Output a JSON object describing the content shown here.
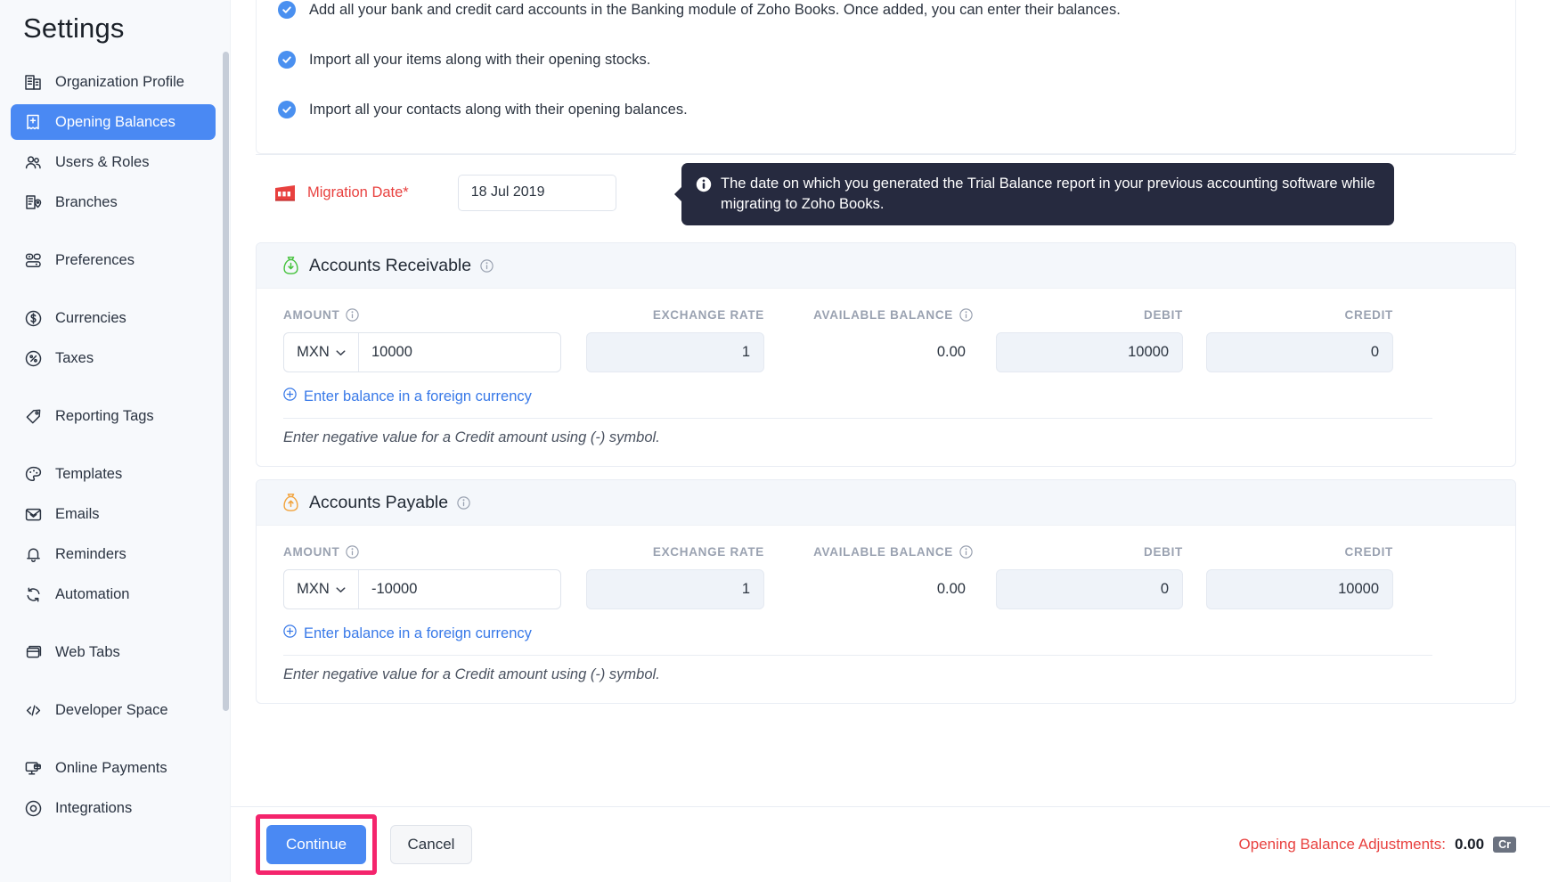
{
  "sidebar": {
    "title": "Settings",
    "items": [
      {
        "label": "Organization Profile",
        "icon": "building-icon",
        "active": false,
        "gap": false
      },
      {
        "label": "Opening Balances",
        "icon": "receipt-plus-icon",
        "active": true,
        "gap": false
      },
      {
        "label": "Users & Roles",
        "icon": "users-icon",
        "active": false,
        "gap": false
      },
      {
        "label": "Branches",
        "icon": "branch-location-icon",
        "active": false,
        "gap": false
      },
      {
        "label": "Preferences",
        "icon": "sliders-icon",
        "active": false,
        "gap": true
      },
      {
        "label": "Currencies",
        "icon": "dollar-circle-icon",
        "active": false,
        "gap": true
      },
      {
        "label": "Taxes",
        "icon": "percent-circle-icon",
        "active": false,
        "gap": false
      },
      {
        "label": "Reporting Tags",
        "icon": "tag-icon",
        "active": false,
        "gap": true
      },
      {
        "label": "Templates",
        "icon": "palette-icon",
        "active": false,
        "gap": true
      },
      {
        "label": "Emails",
        "icon": "envelope-icon",
        "active": false,
        "gap": false
      },
      {
        "label": "Reminders",
        "icon": "bell-icon",
        "active": false,
        "gap": false
      },
      {
        "label": "Automation",
        "icon": "refresh-icon",
        "active": false,
        "gap": false
      },
      {
        "label": "Web Tabs",
        "icon": "layers-icon",
        "active": false,
        "gap": true
      },
      {
        "label": "Developer Space",
        "icon": "code-icon",
        "active": false,
        "gap": true
      },
      {
        "label": "Online Payments",
        "icon": "monitor-payment-icon",
        "active": false,
        "gap": true
      },
      {
        "label": "Integrations",
        "icon": "integrations-icon",
        "active": false,
        "gap": false
      }
    ]
  },
  "checklist": {
    "items": [
      "Add all your bank and credit card accounts in the Banking module of Zoho Books. Once added, you can enter their balances.",
      "Import all your items along with their opening stocks.",
      "Import all your contacts along with their opening balances."
    ]
  },
  "migration": {
    "icon": "calendar-icon",
    "label": "Migration Date*",
    "date_value": "18 Jul 2019",
    "tooltip": "The date on which you generated the Trial Balance report in your previous accounting software while migrating to Zoho Books."
  },
  "columns": {
    "amount": "AMOUNT",
    "exchange_rate": "EXCHANGE RATE",
    "available_balance": "AVAILABLE BALANCE",
    "debit": "DEBIT",
    "credit": "CREDIT"
  },
  "sections": [
    {
      "title": "Accounts Receivable",
      "icon": "money-bag-in-icon",
      "icon_color": "#45c23c",
      "currency": "MXN",
      "amount": "10000",
      "exchange_rate": "1",
      "available_balance": "0.00",
      "debit": "10000",
      "credit": "0",
      "fx_link": "Enter balance in a foreign currency",
      "hint": "Enter negative value for a Credit amount using (-) symbol."
    },
    {
      "title": "Accounts Payable",
      "icon": "money-bag-out-icon",
      "icon_color": "#f2a33c",
      "currency": "MXN",
      "amount": "-10000",
      "exchange_rate": "1",
      "available_balance": "0.00",
      "debit": "0",
      "credit": "10000",
      "fx_link": "Enter balance in a foreign currency",
      "hint": "Enter negative value for a Credit amount using (-) symbol."
    }
  ],
  "footer": {
    "continue_label": "Continue",
    "cancel_label": "Cancel",
    "adjustments_label": "Opening Balance Adjustments:",
    "adjustments_amount": "0.00",
    "adjustments_tag": "Cr"
  },
  "colors": {
    "accent": "#4a89f3",
    "danger": "#e8413f",
    "highlight": "#f4246c",
    "tooltip_bg": "#262a3f"
  }
}
